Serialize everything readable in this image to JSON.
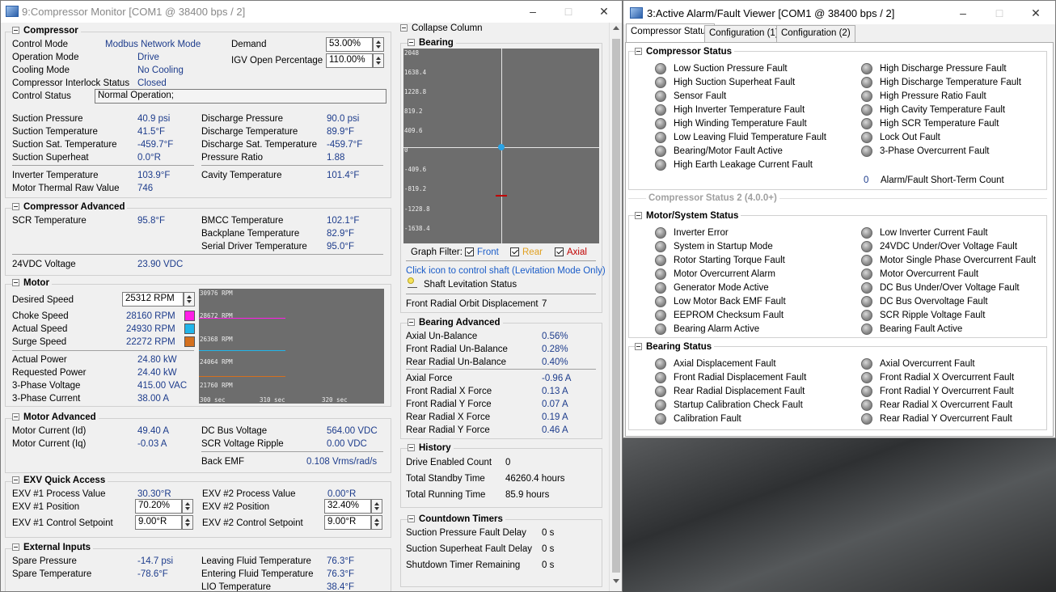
{
  "left_window": {
    "title": "9:Compressor Monitor [COM1 @ 38400 bps / 2]",
    "compressor": {
      "header": "Compressor",
      "control_mode": {
        "label": "Control Mode",
        "value": "Modbus Network Mode"
      },
      "operation_mode": {
        "label": "Operation Mode",
        "value": "Drive"
      },
      "cooling_mode": {
        "label": "Cooling Mode",
        "value": "No Cooling"
      },
      "interlock": {
        "label": "Compressor Interlock Status",
        "value": "Closed"
      },
      "control_status": {
        "label": "Control Status",
        "value": "Normal Operation;"
      },
      "demand": {
        "label": "Demand",
        "value": "53.00%"
      },
      "igv": {
        "label": "IGV Open Percentage",
        "value": "110.00%"
      },
      "suction_pressure": {
        "label": "Suction Pressure",
        "value": "40.9 psi"
      },
      "suction_temp": {
        "label": "Suction Temperature",
        "value": "41.5°F"
      },
      "suction_sat_temp": {
        "label": "Suction Sat. Temperature",
        "value": "-459.7°F"
      },
      "suction_superheat": {
        "label": "Suction Superheat",
        "value": "0.0°R"
      },
      "discharge_pressure": {
        "label": "Discharge Pressure",
        "value": "90.0 psi"
      },
      "discharge_temp": {
        "label": "Discharge Temperature",
        "value": "89.9°F"
      },
      "discharge_sat_temp": {
        "label": "Discharge Sat. Temperature",
        "value": "-459.7°F"
      },
      "pressure_ratio": {
        "label": "Pressure Ratio",
        "value": "1.88"
      },
      "inverter_temp": {
        "label": "Inverter Temperature",
        "value": "103.9°F"
      },
      "motor_thermal": {
        "label": "Motor Thermal Raw Value",
        "value": "746"
      },
      "cavity_temp": {
        "label": "Cavity Temperature",
        "value": "101.4°F"
      }
    },
    "compressor_advanced": {
      "header": "Compressor Advanced",
      "scr_temp": {
        "label": "SCR Temperature",
        "value": "95.8°F"
      },
      "bmcc_temp": {
        "label": "BMCC Temperature",
        "value": "102.1°F"
      },
      "backplane_temp": {
        "label": "Backplane Temperature",
        "value": "82.9°F"
      },
      "serial_driver_temp": {
        "label": "Serial Driver Temperature",
        "value": "95.0°F"
      },
      "vdc24": {
        "label": "24VDC Voltage",
        "value": "23.90 VDC"
      }
    },
    "motor": {
      "header": "Motor",
      "desired_speed": {
        "label": "Desired Speed",
        "value": "25312 RPM"
      },
      "choke_speed": {
        "label": "Choke Speed",
        "value": "28160 RPM",
        "color": "#ff1ee6"
      },
      "actual_speed": {
        "label": "Actual Speed",
        "value": "24930 RPM",
        "color": "#21b5ea"
      },
      "surge_speed": {
        "label": "Surge Speed",
        "value": "22272 RPM",
        "color": "#d4701e"
      },
      "actual_power": {
        "label": "Actual Power",
        "value": "24.80 kW"
      },
      "requested_power": {
        "label": "Requested Power",
        "value": "24.40 kW"
      },
      "phase_voltage": {
        "label": "3-Phase Voltage",
        "value": "415.00 VAC"
      },
      "phase_current": {
        "label": "3-Phase Current",
        "value": "38.00 A"
      },
      "graph_y_ticks": [
        "30976 RPM",
        "28672 RPM",
        "26368 RPM",
        "24064 RPM",
        "21760 RPM"
      ],
      "graph_x_ticks": [
        "300 sec",
        "310 sec",
        "320 sec"
      ]
    },
    "motor_advanced": {
      "header": "Motor Advanced",
      "current_id": {
        "label": "Motor Current (Id)",
        "value": "49.40 A"
      },
      "current_iq": {
        "label": "Motor Current (Iq)",
        "value": "-0.03 A"
      },
      "dc_bus": {
        "label": "DC Bus Voltage",
        "value": "564.00 VDC"
      },
      "scr_ripple": {
        "label": "SCR Voltage Ripple",
        "value": "0.00 VDC"
      },
      "back_emf": {
        "label": "Back EMF",
        "value": "0.108 Vrms/rad/s"
      }
    },
    "exv": {
      "header": "EXV Quick Access",
      "exv1_pv": {
        "label": "EXV #1 Process Value",
        "value": "30.30°R"
      },
      "exv1_pos": {
        "label": "EXV #1 Position",
        "value": "70.20%"
      },
      "exv1_sp": {
        "label": "EXV #1 Control Setpoint",
        "value": "9.00°R"
      },
      "exv2_pv": {
        "label": "EXV #2 Process Value",
        "value": "0.00°R"
      },
      "exv2_pos": {
        "label": "EXV #2 Position",
        "value": "32.40%"
      },
      "exv2_sp": {
        "label": "EXV #2 Control Setpoint",
        "value": "9.00°R"
      }
    },
    "external": {
      "header": "External Inputs",
      "spare_pressure": {
        "label": "Spare Pressure",
        "value": "-14.7 psi"
      },
      "spare_temp": {
        "label": "Spare Temperature",
        "value": "-78.6°F"
      },
      "leaving_fluid": {
        "label": "Leaving Fluid Temperature",
        "value": "76.3°F"
      },
      "entering_fluid": {
        "label": "Entering Fluid Temperature",
        "value": "76.3°F"
      },
      "lio_temp": {
        "label": "LIO Temperature",
        "value": "38.4°F"
      }
    },
    "collapse_column": "Collapse Column",
    "bearing": {
      "header": "Bearing",
      "y_ticks": [
        "2048",
        "1638.4",
        "1228.8",
        "819.2",
        "409.6",
        "0",
        "-409.6",
        "-819.2",
        "-1228.8",
        "-1638.4"
      ],
      "graph_filter": "Graph Filter:",
      "filter_front": "Front",
      "filter_rear": "Rear",
      "filter_axial": "Axial",
      "front_color": "#1a5cc8",
      "rear_color": "#e0a020",
      "axial_color": "#c00000",
      "click_hint": "Click icon to control shaft (Levitation Mode Only)",
      "levitation": "Shaft Levitation Status",
      "orbit": {
        "label": "Front Radial Orbit Displacement",
        "value": "7"
      }
    },
    "bearing_advanced": {
      "header": "Bearing Advanced",
      "axial_unbal": {
        "label": "Axial Un-Balance",
        "value": "0.56%"
      },
      "front_unbal": {
        "label": "Front Radial Un-Balance",
        "value": "0.28%"
      },
      "rear_unbal": {
        "label": "Rear Radial Un-Balance",
        "value": "0.40%"
      },
      "axial_force": {
        "label": "Axial Force",
        "value": "-0.96 A"
      },
      "front_x": {
        "label": "Front Radial X Force",
        "value": "0.13 A"
      },
      "front_y": {
        "label": "Front Radial Y Force",
        "value": "0.07 A"
      },
      "rear_x": {
        "label": "Rear Radial X Force",
        "value": "0.19 A"
      },
      "rear_y": {
        "label": "Rear Radial Y Force",
        "value": "0.46 A"
      }
    },
    "history": {
      "header": "History",
      "drive_enabled": {
        "label": "Drive Enabled Count",
        "value": "0"
      },
      "standby": {
        "label": "Total Standby Time",
        "value": "46260.4 hours"
      },
      "running": {
        "label": "Total Running Time",
        "value": "85.9 hours"
      }
    },
    "countdown": {
      "header": "Countdown Timers",
      "suction_pressure_delay": {
        "label": "Suction Pressure Fault Delay",
        "value": "0 s"
      },
      "suction_superheat_delay": {
        "label": "Suction Superheat Fault Delay",
        "value": "0 s"
      },
      "shutdown": {
        "label": "Shutdown Timer Remaining",
        "value": "0 s"
      }
    }
  },
  "right_window": {
    "title": "3:Active Alarm/Fault Viewer [COM1 @ 38400 bps / 2]",
    "tabs": [
      "Compressor Status",
      "Configuration (1)",
      "Configuration (2)"
    ],
    "compressor_status": {
      "header": "Compressor Status",
      "left": [
        "Low Suction Pressure Fault",
        "High Suction Superheat Fault",
        "Sensor Fault",
        "High Inverter Temperature Fault",
        "High Winding Temperature Fault",
        "Low Leaving Fluid Temperature Fault",
        "Bearing/Motor Fault Active",
        "High Earth Leakage Current Fault"
      ],
      "right": [
        "High Discharge Pressure Fault",
        "High Discharge Temperature Fault",
        "High Pressure Ratio Fault",
        "High Cavity Temperature Fault",
        "High SCR Temperature Fault",
        "Lock Out Fault",
        "3-Phase Overcurrent Fault"
      ],
      "count_value": "0",
      "count_label": "Alarm/Fault Short-Term Count"
    },
    "status2_header": "Compressor Status 2 (4.0.0+)",
    "motor_system": {
      "header": "Motor/System Status",
      "left": [
        "Inverter Error",
        "System in Startup Mode",
        "Rotor Starting Torque Fault",
        "Motor Overcurrent Alarm",
        "Generator Mode Active",
        "Low Motor Back EMF Fault",
        "EEPROM Checksum Fault",
        "Bearing Alarm Active"
      ],
      "right": [
        "Low Inverter Current Fault",
        "24VDC Under/Over Voltage Fault",
        "Motor Single Phase Overcurrent Fault",
        "Motor Overcurrent Fault",
        "DC Bus Under/Over Voltage Fault",
        "DC Bus Overvoltage Fault",
        "SCR Ripple Voltage Fault",
        "Bearing Fault Active"
      ]
    },
    "bearing_status": {
      "header": "Bearing Status",
      "left": [
        "Axial Displacement Fault",
        "Front Radial Displacement Fault",
        "Rear Radial Displacement Fault",
        "Startup Calibration Check Fault",
        "Calibration Fault"
      ],
      "right": [
        "Axial Overcurrent Fault",
        "Front Radial X Overcurrent Fault",
        "Front Radial Y Overcurrent Fault",
        "Rear Radial X Overcurrent Fault",
        "Rear Radial Y Overcurrent Fault"
      ]
    }
  }
}
